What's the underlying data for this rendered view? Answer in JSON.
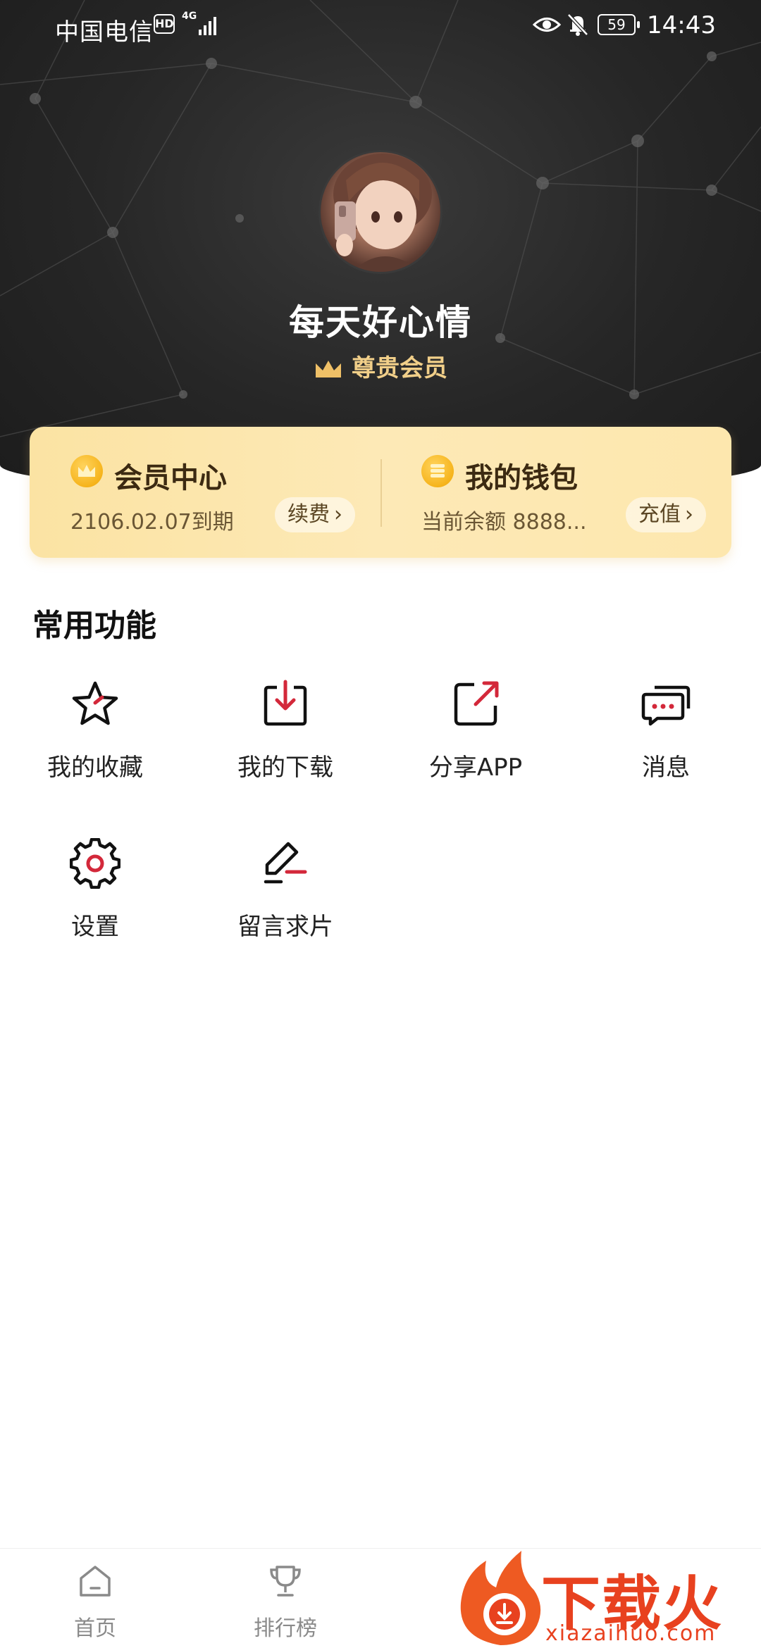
{
  "status_bar": {
    "carrier": "中国电信",
    "hd_badge": "HD",
    "network": "4G",
    "battery": "59",
    "time": "14:43"
  },
  "profile": {
    "username": "每天好心情",
    "vip_label": "尊贵会员"
  },
  "member_card": {
    "title": "会员中心",
    "expiry": "2106.02.07到期",
    "action": "续费"
  },
  "wallet_card": {
    "title": "我的钱包",
    "balance": "当前余额 8888...",
    "action": "充值"
  },
  "features": {
    "title": "常用功能",
    "items": [
      {
        "label": "我的收藏",
        "icon": "star-icon"
      },
      {
        "label": "我的下载",
        "icon": "download-icon"
      },
      {
        "label": "分享APP",
        "icon": "share-icon"
      },
      {
        "label": "消息",
        "icon": "message-icon"
      },
      {
        "label": "设置",
        "icon": "gear-icon"
      },
      {
        "label": "留言求片",
        "icon": "edit-icon"
      }
    ]
  },
  "bottom_nav": {
    "items": [
      {
        "label": "首页",
        "icon": "home-icon"
      },
      {
        "label": "排行榜",
        "icon": "trophy-icon"
      }
    ]
  },
  "watermark": {
    "title": "下载火",
    "url": "xiazaihuo.com"
  },
  "colors": {
    "accent_red": "#d3283a",
    "gold_text": "#f1cf89",
    "card_gold": "#fbe3a3"
  }
}
